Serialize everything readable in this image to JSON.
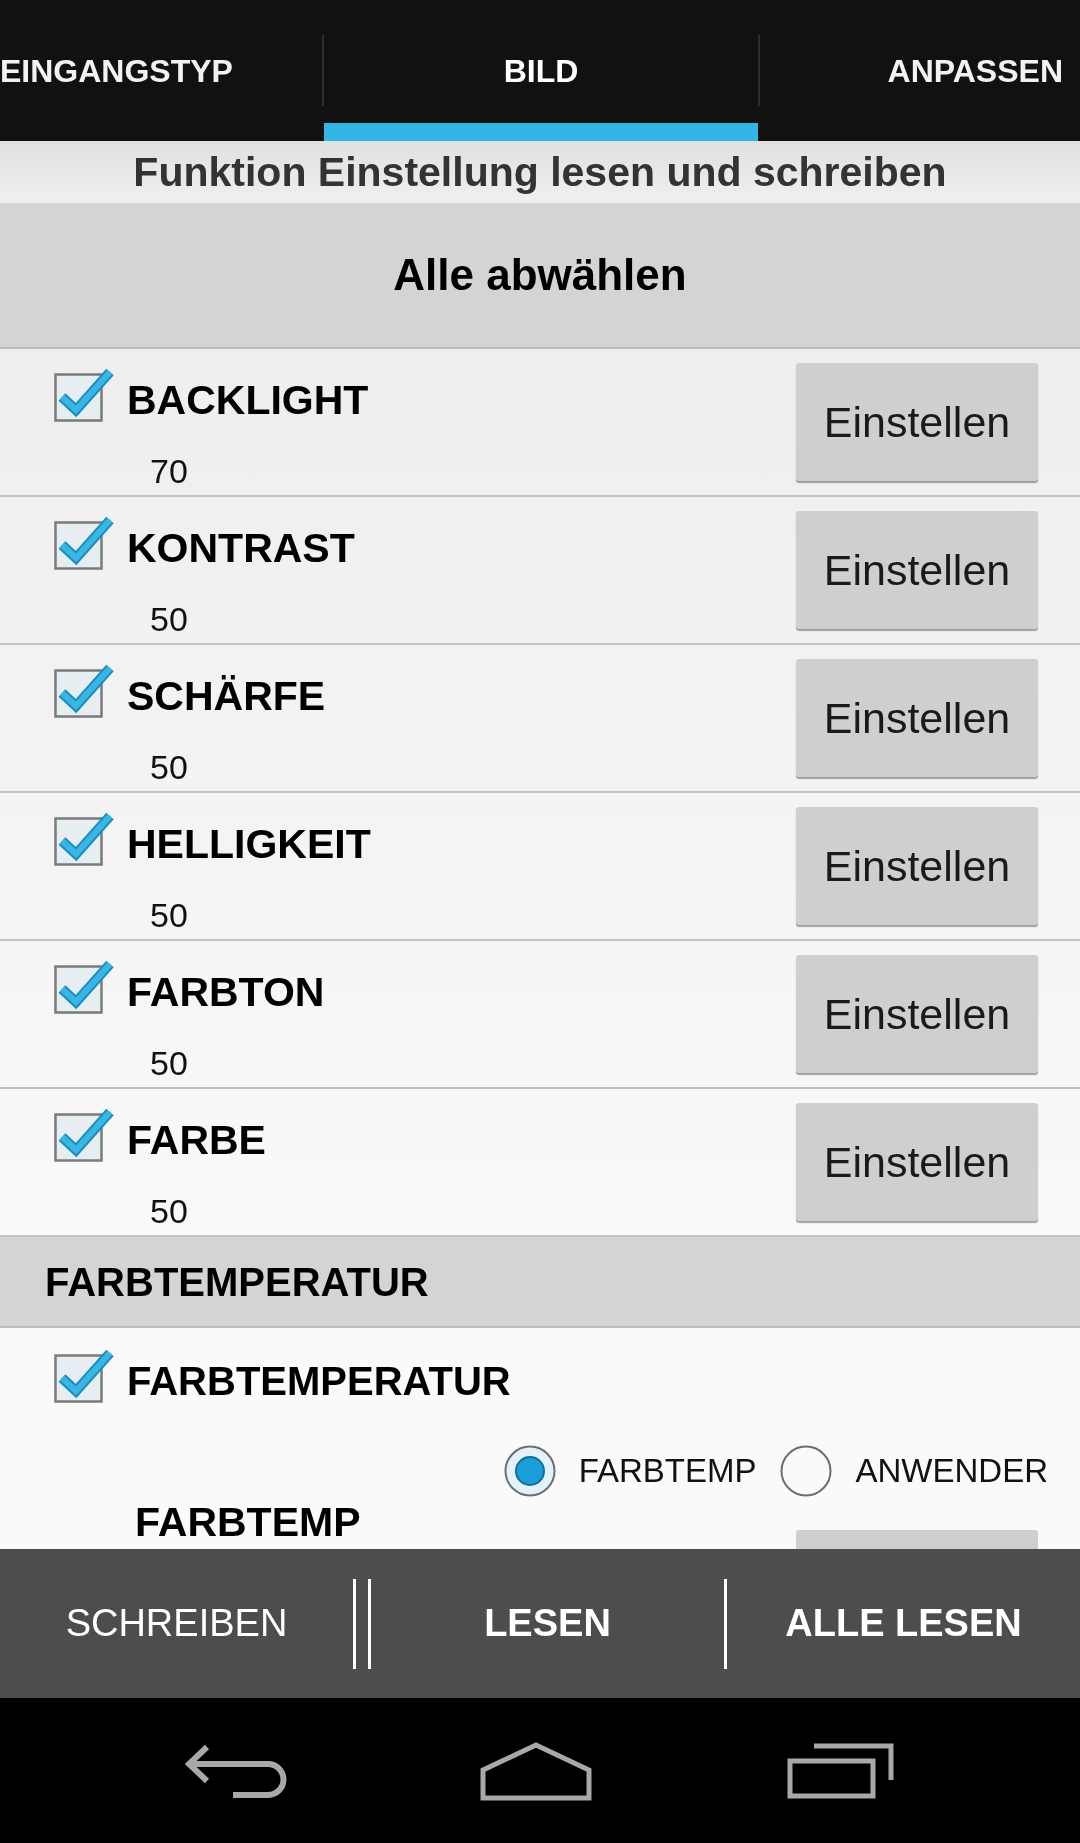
{
  "tabs": [
    {
      "label": "EINGANGSTYP",
      "selected": false
    },
    {
      "label": "BILD",
      "selected": true
    },
    {
      "label": "ANPASSEN",
      "selected": false
    }
  ],
  "subtitle": "Funktion Einstellung lesen und schreiben",
  "deselect_all_button": "Alle abwählen",
  "settings": [
    {
      "name": "BACKLIGHT",
      "checked": true,
      "value": "70",
      "button": "Einstellen"
    },
    {
      "name": "KONTRAST",
      "checked": true,
      "value": "50",
      "button": "Einstellen"
    },
    {
      "name": "SCHÄRFE",
      "checked": true,
      "value": "50",
      "button": "Einstellen"
    },
    {
      "name": "HELLIGKEIT",
      "checked": true,
      "value": "50",
      "button": "Einstellen"
    },
    {
      "name": "FARBTON",
      "checked": true,
      "value": "50",
      "button": "Einstellen"
    },
    {
      "name": "FARBE",
      "checked": true,
      "value": "50",
      "button": "Einstellen"
    }
  ],
  "section": {
    "title": "FARBTEMPERATUR",
    "setting": {
      "name": "FARBTEMPERATUR",
      "checked": true,
      "options": [
        {
          "label": "FARBTEMP",
          "selected": true
        },
        {
          "label": "ANWENDER",
          "selected": false
        }
      ]
    },
    "next_row": {
      "name": "FARBTEMP"
    }
  },
  "action_bar": [
    {
      "label": "SCHREIBEN",
      "emphasized": false
    },
    {
      "label": "LESEN",
      "emphasized": true
    },
    {
      "label": "ALLE LESEN",
      "emphasized": true
    }
  ]
}
